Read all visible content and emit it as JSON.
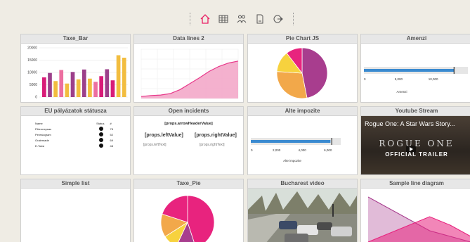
{
  "toolbar": {
    "icons": [
      "home-icon",
      "table-icon",
      "users-icon",
      "document-icon",
      "logout-icon"
    ],
    "accent": "#e91e63"
  },
  "panels": {
    "taxe_bar": {
      "title": "Taxe_Bar"
    },
    "data_lines": {
      "title": "Data lines 2"
    },
    "pie_js": {
      "title": "Pie Chart JS"
    },
    "amenzi": {
      "title": "Amenzi",
      "axis_label": "Amenzi"
    },
    "eu": {
      "title": "EU pályázatok státusza",
      "headers": [
        "Name",
        "Status",
        "#"
      ],
      "rows": [
        [
          "Fittermepsas",
          "",
          "78"
        ],
        [
          "Pereslogram",
          "",
          "52"
        ],
        [
          "Gralemade",
          "",
          "69"
        ],
        [
          "E-Toksi",
          "",
          "48"
        ]
      ]
    },
    "incidents": {
      "title": "Open incidents",
      "header": "[props.arrowHeaderValue]",
      "left_value": "[props.leftValue]",
      "right_value": "[props.rightValue]",
      "left_text": "[props.leftText]",
      "right_text": "[props.rightText]"
    },
    "alte": {
      "title": "Alte impozite",
      "axis_label": "Alte impozite"
    },
    "youtube": {
      "title": "Youtube Stream",
      "video_title": "Rogue One: A Star Wars Story...",
      "logo": "ROGUE ONE",
      "subtitle": "OFFICIAL TRAILER"
    },
    "simple_list": {
      "title": "Simple list"
    },
    "taxe_pie": {
      "title": "Taxe_Pie"
    },
    "bucharest": {
      "title": "Bucharest video"
    },
    "sample_line": {
      "title": "Sample line diagram"
    }
  },
  "chart_data": [
    {
      "type": "bar",
      "title": "Taxe_Bar",
      "categories": [
        "1",
        "2",
        "3",
        "4",
        "5",
        "6",
        "7",
        "8",
        "9",
        "10",
        "11",
        "12",
        "13",
        "14",
        "15"
      ],
      "values": [
        8000,
        9800,
        6500,
        11000,
        5500,
        10200,
        7200,
        11200,
        7500,
        6200,
        8500,
        11300,
        6800,
        17000,
        16000
      ],
      "colors": [
        "#d81b78",
        "#9c3f8a",
        "#f2bd3f",
        "#ec6fa0",
        "#f2bd3f",
        "#9c3f8a",
        "#f2bd3f",
        "#9c3f8a",
        "#f2bd3f",
        "#ec6fa0",
        "#d81b78",
        "#9c3f8a",
        "#d81b78",
        "#f2bd3f",
        "#f2bd3f"
      ],
      "ylim": [
        0,
        20000
      ],
      "yticks": [
        "0",
        "5000",
        "10000",
        "15000",
        "20000"
      ],
      "grid": true
    },
    {
      "type": "area",
      "title": "Data lines 2",
      "x": [
        0,
        1,
        2,
        3,
        4,
        5,
        6,
        7,
        8,
        9,
        10
      ],
      "values": [
        4,
        6,
        7,
        10,
        18,
        30,
        42,
        55,
        65,
        72,
        76
      ],
      "ylim": [
        0,
        100
      ],
      "color": "#e8388a",
      "grid": true
    },
    {
      "type": "pie",
      "title": "Pie Chart JS",
      "values": [
        45,
        28,
        13,
        10
      ],
      "colors": [
        "#a83d8e",
        "#f2a84a",
        "#f7d23e",
        "#e8237e"
      ]
    },
    {
      "type": "bar",
      "title": "Amenzi",
      "orientation": "horizontal",
      "values": [
        13000
      ],
      "marker": 13000,
      "xlim": [
        0,
        15000
      ],
      "xticks": [
        "0",
        "5,000",
        "10,000"
      ],
      "color": "#3a8ad0"
    },
    {
      "type": "bar",
      "title": "Alte impozite",
      "orientation": "horizontal",
      "values": [
        6200
      ],
      "marker": 6300,
      "xlim": [
        0,
        7000
      ],
      "xticks": [
        "0",
        "2,000",
        "4,000",
        "6,000"
      ],
      "color": "#3a8ad0"
    },
    {
      "type": "pie",
      "title": "Taxe_Pie",
      "values": [
        45,
        12,
        9,
        14,
        20
      ],
      "colors": [
        "#e8237e",
        "#a83d8e",
        "#f7d23e",
        "#f2a84a",
        "#e8237e"
      ]
    },
    {
      "type": "area",
      "title": "Sample line diagram",
      "series": [
        {
          "values": [
            90,
            70,
            50,
            30,
            20,
            10
          ],
          "color": "#a83d8e"
        },
        {
          "values": [
            10,
            25,
            40,
            55,
            40,
            20
          ],
          "color": "#e8237e"
        }
      ],
      "ylim": [
        0,
        100
      ]
    }
  ]
}
